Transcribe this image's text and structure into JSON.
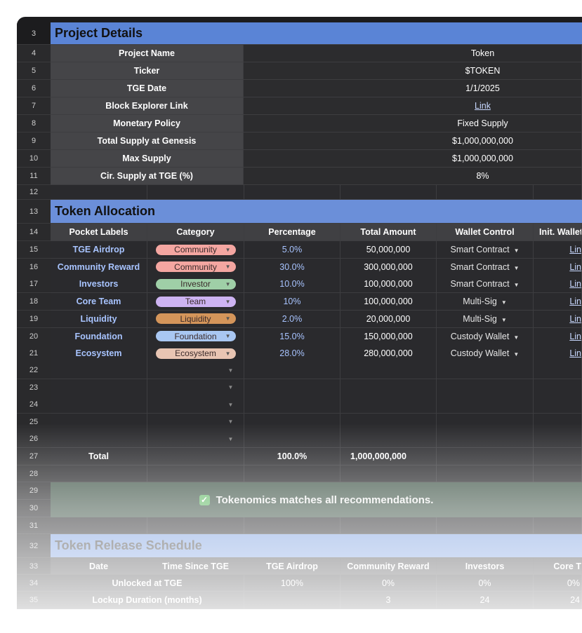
{
  "row_numbers": [
    "3",
    "4",
    "5",
    "6",
    "7",
    "8",
    "9",
    "10",
    "11",
    "12",
    "13",
    "14",
    "15",
    "16",
    "17",
    "18",
    "19",
    "20",
    "21",
    "22",
    "23",
    "24",
    "25",
    "26",
    "27",
    "28",
    "29",
    "30",
    "31",
    "32",
    "33",
    "34",
    "35"
  ],
  "project_details": {
    "title": "Project Details",
    "rows": [
      {
        "label": "Project Name",
        "value": "Token"
      },
      {
        "label": "Ticker",
        "value": "$TOKEN"
      },
      {
        "label": "TGE Date",
        "value": "1/1/2025"
      },
      {
        "label": "Block Explorer Link",
        "value": "Link"
      },
      {
        "label": "Monetary Policy",
        "value": "Fixed Supply"
      },
      {
        "label": "Total Supply at Genesis",
        "value": "$1,000,000,000"
      },
      {
        "label": "Max Supply",
        "value": "$1,000,000,000"
      },
      {
        "label": "Cir. Supply at TGE (%)",
        "value": "8%"
      }
    ]
  },
  "token_allocation": {
    "title": "Token Allocation",
    "headers": [
      "Pocket Labels",
      "Category",
      "Percentage",
      "Total Amount",
      "Wallet Control",
      "Init. Wallet"
    ],
    "rows": [
      {
        "label": "TGE Airdrop",
        "category": "Community",
        "percentage": "5.0%",
        "amount": "50,000,000",
        "wallet": "Smart Contract",
        "link": "Lin"
      },
      {
        "label": "Community Reward",
        "category": "Community",
        "percentage": "30.0%",
        "amount": "300,000,000",
        "wallet": "Smart Contract",
        "link": "Lin"
      },
      {
        "label": "Investors",
        "category": "Investor",
        "percentage": "10.0%",
        "amount": "100,000,000",
        "wallet": "Smart Contract",
        "link": "Lin"
      },
      {
        "label": "Core Team",
        "category": "Team",
        "percentage": "10%",
        "amount": "100,000,000",
        "wallet": "Multi-Sig",
        "link": "Lin"
      },
      {
        "label": "Liquidity",
        "category": "Liquidity",
        "percentage": "2.0%",
        "amount": "20,000,000",
        "wallet": "Multi-Sig",
        "link": "Lin"
      },
      {
        "label": "Foundation",
        "category": "Foundation",
        "percentage": "15.0%",
        "amount": "150,000,000",
        "wallet": "Custody Wallet",
        "link": "Lin"
      },
      {
        "label": "Ecosystem",
        "category": "Ecosystem",
        "percentage": "28.0%",
        "amount": "280,000,000",
        "wallet": "Custody Wallet",
        "link": "Lin"
      }
    ],
    "total": {
      "label": "Total",
      "percentage": "100.0%",
      "amount": "1,000,000,000"
    }
  },
  "category_colors": {
    "Community": "#f4a6a1",
    "Investor": "#9fcfa7",
    "Team": "#cdb3f2",
    "Liquidity": "#d4955a",
    "Foundation": "#a9c7f2",
    "Ecosystem": "#e8c5b3"
  },
  "status": {
    "icon": "checkbox-checked-icon",
    "message": "Tokenomics matches all recommendations."
  },
  "release_schedule": {
    "title": "Token Release Schedule",
    "headers": [
      "Date",
      "Time Since TGE",
      "TGE Airdrop",
      "Community Reward",
      "Investors",
      "Core T"
    ],
    "unlocked_row": {
      "label": "Unlocked at TGE",
      "values": [
        "100%",
        "0%",
        "0%",
        "0%"
      ]
    },
    "lockup_row": {
      "label": "Lockup Duration (months)",
      "values": [
        "",
        "3",
        "24",
        "24"
      ]
    }
  }
}
